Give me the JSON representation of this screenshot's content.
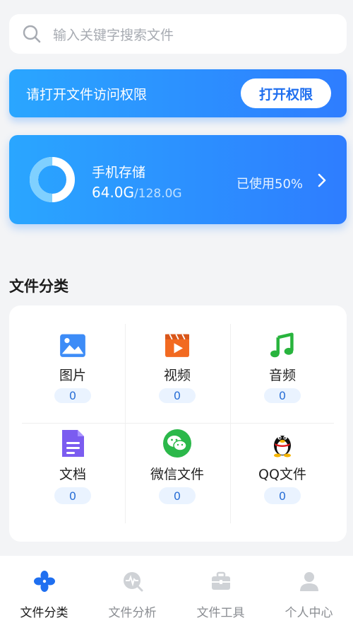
{
  "search": {
    "placeholder": "输入关键字搜索文件",
    "icon": "search-icon"
  },
  "permission": {
    "message": "请打开文件访问权限",
    "button_label": "打开权限"
  },
  "storage": {
    "title": "手机存储",
    "used": "64.0G",
    "total": "/128.0G",
    "used_text": "已使用50%",
    "used_fraction": 0.5
  },
  "section_title": "文件分类",
  "categories": [
    {
      "label": "图片",
      "count": "0",
      "icon": "image-icon"
    },
    {
      "label": "视频",
      "count": "0",
      "icon": "video-icon"
    },
    {
      "label": "音频",
      "count": "0",
      "icon": "music-icon"
    },
    {
      "label": "文档",
      "count": "0",
      "icon": "document-icon"
    },
    {
      "label": "微信文件",
      "count": "0",
      "icon": "wechat-icon"
    },
    {
      "label": "QQ文件",
      "count": "0",
      "icon": "qq-icon"
    }
  ],
  "tabs": [
    {
      "label": "文件分类",
      "icon": "category-icon",
      "active": true
    },
    {
      "label": "文件分析",
      "icon": "analysis-icon",
      "active": false
    },
    {
      "label": "文件工具",
      "icon": "toolbox-icon",
      "active": false
    },
    {
      "label": "个人中心",
      "icon": "profile-icon",
      "active": false
    }
  ],
  "colors": {
    "accent": "#2e7dff",
    "accent_light": "#2aa6ff",
    "badge_bg": "#eaf3ff"
  }
}
